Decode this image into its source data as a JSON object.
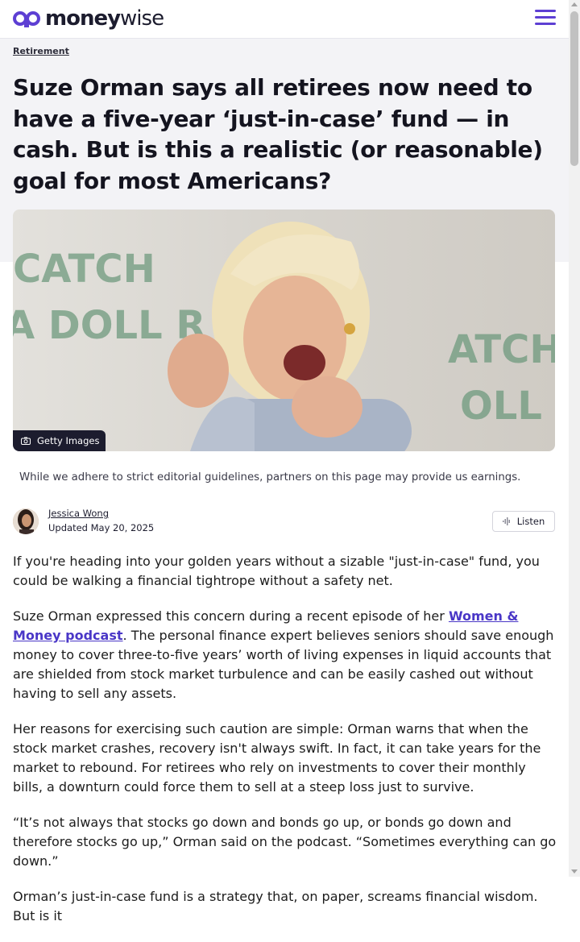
{
  "header": {
    "logo_money": "money",
    "logo_wise": "wise",
    "menu_icon": "hamburger-icon",
    "accent_color": "#5d3fd3"
  },
  "breadcrumb": "Retirement",
  "article": {
    "headline": "Suze Orman says all retirees now need to have a five-year ‘just-in-case’ fund — in cash. But is this a realistic (or reasonable) goal for most Americans?",
    "photo_credit": "Getty Images",
    "photo_icon": "camera-icon",
    "disclaimer": "While we adhere to strict editorial guidelines, partners on this page may provide us earnings.",
    "author": {
      "name": "Jessica Wong",
      "updated": "Updated May 20, 2025"
    },
    "listen_label": "Listen",
    "paragraphs": {
      "p1": "If you're heading into your golden years without a sizable \"just-in-case\" fund, you could be walking a financial tightrope without a safety net.",
      "p2_before": "Suze Orman expressed this concern during a recent episode of her ",
      "p2_link": "Women & Money podcast",
      "p2_after": ". The personal finance expert believes seniors should save enough money to cover three-to-five years’ worth of living expenses in liquid accounts that are shielded from stock market turbulence and can be easily cashed out without having to sell any assets.",
      "p3": "Her reasons for exercising such caution are simple: Orman warns that when the stock market crashes, recovery isn't always swift. In fact, it can take years for the market to rebound. For retirees who rely on investments to cover their monthly bills, a downturn could force them to sell at a steep loss just to survive.",
      "p4": "“It’s not always that stocks go down and bonds go up, or bonds go down and therefore stocks go up,” Orman said on the podcast. “Sometimes everything can go down.”",
      "p5": "Orman’s just-in-case fund is a strategy that, on paper, screams financial wisdom. But is it"
    }
  }
}
